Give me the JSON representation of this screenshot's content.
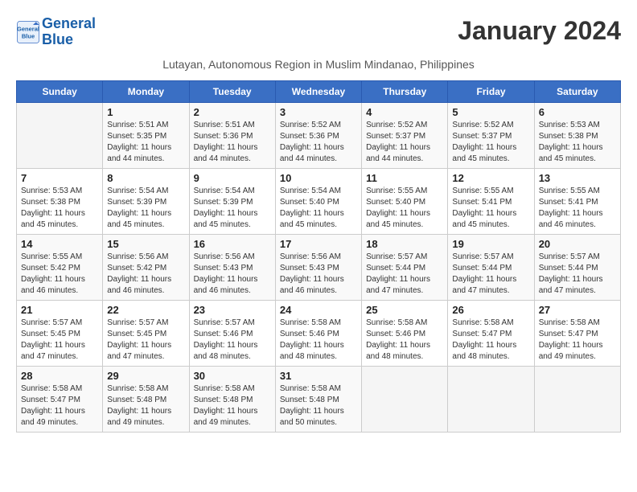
{
  "logo": {
    "line1": "General",
    "line2": "Blue"
  },
  "title": "January 2024",
  "location": "Lutayan, Autonomous Region in Muslim Mindanao, Philippines",
  "days_header": [
    "Sunday",
    "Monday",
    "Tuesday",
    "Wednesday",
    "Thursday",
    "Friday",
    "Saturday"
  ],
  "weeks": [
    [
      {
        "day": "",
        "sunrise": "",
        "sunset": "",
        "daylight": ""
      },
      {
        "day": "1",
        "sunrise": "Sunrise: 5:51 AM",
        "sunset": "Sunset: 5:35 PM",
        "daylight": "Daylight: 11 hours and 44 minutes."
      },
      {
        "day": "2",
        "sunrise": "Sunrise: 5:51 AM",
        "sunset": "Sunset: 5:36 PM",
        "daylight": "Daylight: 11 hours and 44 minutes."
      },
      {
        "day": "3",
        "sunrise": "Sunrise: 5:52 AM",
        "sunset": "Sunset: 5:36 PM",
        "daylight": "Daylight: 11 hours and 44 minutes."
      },
      {
        "day": "4",
        "sunrise": "Sunrise: 5:52 AM",
        "sunset": "Sunset: 5:37 PM",
        "daylight": "Daylight: 11 hours and 44 minutes."
      },
      {
        "day": "5",
        "sunrise": "Sunrise: 5:52 AM",
        "sunset": "Sunset: 5:37 PM",
        "daylight": "Daylight: 11 hours and 45 minutes."
      },
      {
        "day": "6",
        "sunrise": "Sunrise: 5:53 AM",
        "sunset": "Sunset: 5:38 PM",
        "daylight": "Daylight: 11 hours and 45 minutes."
      }
    ],
    [
      {
        "day": "7",
        "sunrise": "Sunrise: 5:53 AM",
        "sunset": "Sunset: 5:38 PM",
        "daylight": "Daylight: 11 hours and 45 minutes."
      },
      {
        "day": "8",
        "sunrise": "Sunrise: 5:54 AM",
        "sunset": "Sunset: 5:39 PM",
        "daylight": "Daylight: 11 hours and 45 minutes."
      },
      {
        "day": "9",
        "sunrise": "Sunrise: 5:54 AM",
        "sunset": "Sunset: 5:39 PM",
        "daylight": "Daylight: 11 hours and 45 minutes."
      },
      {
        "day": "10",
        "sunrise": "Sunrise: 5:54 AM",
        "sunset": "Sunset: 5:40 PM",
        "daylight": "Daylight: 11 hours and 45 minutes."
      },
      {
        "day": "11",
        "sunrise": "Sunrise: 5:55 AM",
        "sunset": "Sunset: 5:40 PM",
        "daylight": "Daylight: 11 hours and 45 minutes."
      },
      {
        "day": "12",
        "sunrise": "Sunrise: 5:55 AM",
        "sunset": "Sunset: 5:41 PM",
        "daylight": "Daylight: 11 hours and 45 minutes."
      },
      {
        "day": "13",
        "sunrise": "Sunrise: 5:55 AM",
        "sunset": "Sunset: 5:41 PM",
        "daylight": "Daylight: 11 hours and 46 minutes."
      }
    ],
    [
      {
        "day": "14",
        "sunrise": "Sunrise: 5:55 AM",
        "sunset": "Sunset: 5:42 PM",
        "daylight": "Daylight: 11 hours and 46 minutes."
      },
      {
        "day": "15",
        "sunrise": "Sunrise: 5:56 AM",
        "sunset": "Sunset: 5:42 PM",
        "daylight": "Daylight: 11 hours and 46 minutes."
      },
      {
        "day": "16",
        "sunrise": "Sunrise: 5:56 AM",
        "sunset": "Sunset: 5:43 PM",
        "daylight": "Daylight: 11 hours and 46 minutes."
      },
      {
        "day": "17",
        "sunrise": "Sunrise: 5:56 AM",
        "sunset": "Sunset: 5:43 PM",
        "daylight": "Daylight: 11 hours and 46 minutes."
      },
      {
        "day": "18",
        "sunrise": "Sunrise: 5:57 AM",
        "sunset": "Sunset: 5:44 PM",
        "daylight": "Daylight: 11 hours and 47 minutes."
      },
      {
        "day": "19",
        "sunrise": "Sunrise: 5:57 AM",
        "sunset": "Sunset: 5:44 PM",
        "daylight": "Daylight: 11 hours and 47 minutes."
      },
      {
        "day": "20",
        "sunrise": "Sunrise: 5:57 AM",
        "sunset": "Sunset: 5:44 PM",
        "daylight": "Daylight: 11 hours and 47 minutes."
      }
    ],
    [
      {
        "day": "21",
        "sunrise": "Sunrise: 5:57 AM",
        "sunset": "Sunset: 5:45 PM",
        "daylight": "Daylight: 11 hours and 47 minutes."
      },
      {
        "day": "22",
        "sunrise": "Sunrise: 5:57 AM",
        "sunset": "Sunset: 5:45 PM",
        "daylight": "Daylight: 11 hours and 47 minutes."
      },
      {
        "day": "23",
        "sunrise": "Sunrise: 5:57 AM",
        "sunset": "Sunset: 5:46 PM",
        "daylight": "Daylight: 11 hours and 48 minutes."
      },
      {
        "day": "24",
        "sunrise": "Sunrise: 5:58 AM",
        "sunset": "Sunset: 5:46 PM",
        "daylight": "Daylight: 11 hours and 48 minutes."
      },
      {
        "day": "25",
        "sunrise": "Sunrise: 5:58 AM",
        "sunset": "Sunset: 5:46 PM",
        "daylight": "Daylight: 11 hours and 48 minutes."
      },
      {
        "day": "26",
        "sunrise": "Sunrise: 5:58 AM",
        "sunset": "Sunset: 5:47 PM",
        "daylight": "Daylight: 11 hours and 48 minutes."
      },
      {
        "day": "27",
        "sunrise": "Sunrise: 5:58 AM",
        "sunset": "Sunset: 5:47 PM",
        "daylight": "Daylight: 11 hours and 49 minutes."
      }
    ],
    [
      {
        "day": "28",
        "sunrise": "Sunrise: 5:58 AM",
        "sunset": "Sunset: 5:47 PM",
        "daylight": "Daylight: 11 hours and 49 minutes."
      },
      {
        "day": "29",
        "sunrise": "Sunrise: 5:58 AM",
        "sunset": "Sunset: 5:48 PM",
        "daylight": "Daylight: 11 hours and 49 minutes."
      },
      {
        "day": "30",
        "sunrise": "Sunrise: 5:58 AM",
        "sunset": "Sunset: 5:48 PM",
        "daylight": "Daylight: 11 hours and 49 minutes."
      },
      {
        "day": "31",
        "sunrise": "Sunrise: 5:58 AM",
        "sunset": "Sunset: 5:48 PM",
        "daylight": "Daylight: 11 hours and 50 minutes."
      },
      {
        "day": "",
        "sunrise": "",
        "sunset": "",
        "daylight": ""
      },
      {
        "day": "",
        "sunrise": "",
        "sunset": "",
        "daylight": ""
      },
      {
        "day": "",
        "sunrise": "",
        "sunset": "",
        "daylight": ""
      }
    ]
  ]
}
